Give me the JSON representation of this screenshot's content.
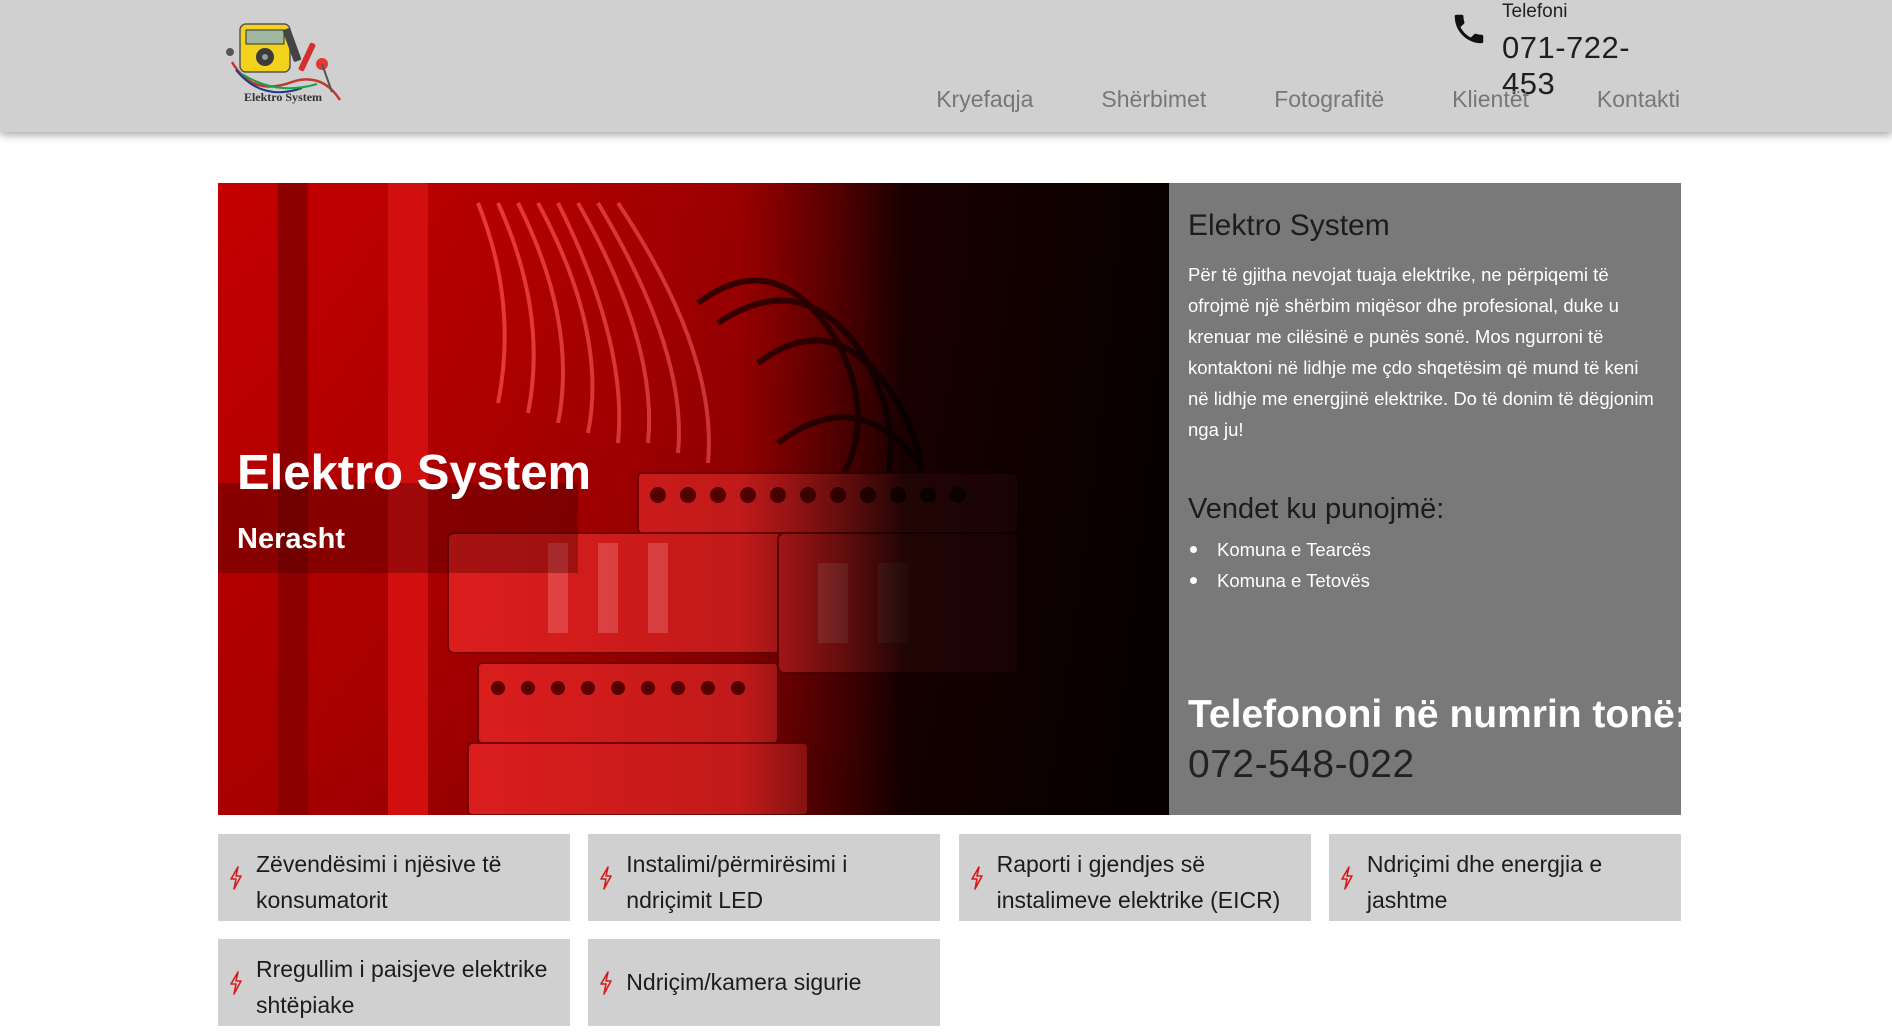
{
  "header": {
    "logo_text": "Elektro System",
    "phone_label": "Telefoni",
    "phone_number": "071-722-453",
    "nav": [
      "Kryefaqja",
      "Shërbimet",
      "Fotografitë",
      "Klientët",
      "Kontakti"
    ]
  },
  "hero": {
    "title": "Elektro System",
    "subtitle": "Nerasht",
    "panel_title": "Elektro System",
    "panel_text": "Për të gjitha nevojat tuaja elektrike, ne përpiqemi të ofrojmë një shërbim miqësor dhe profesional, duke u krenuar me cilësinë e punës sonë. Mos ngurroni të kontaktoni në lidhje me çdo shqetësim që mund të keni në lidhje me energjinë elektrike. Do të donim të dëgjonim nga ju!",
    "places_title": "Vendet ku punojmë:",
    "places": [
      "Komuna e Tearcës",
      "Komuna e Tetovës"
    ],
    "call_title": "Telefononi në numrin tonë:",
    "call_number": "072-548-022"
  },
  "services": [
    "Zëvendësimi i njësive të konsumatorit",
    "Instalimi/përmirësimi i ndriçimit LED",
    "Raporti i gjendjes së instalimeve elektrike (EICR)",
    "Ndriçimi dhe energjia e jashtme",
    "Rregullim i paisjeve elektrike shtëpiake",
    "Ndriçim/kamera sigurie"
  ],
  "icons": {
    "phone": "phone-icon",
    "service": "lightning-bolt-icon"
  },
  "colors": {
    "header_bg": "#d0d0d0",
    "panel_bg": "#797979",
    "card_bg": "#d0d0d0",
    "accent_red": "#d81b1b"
  }
}
